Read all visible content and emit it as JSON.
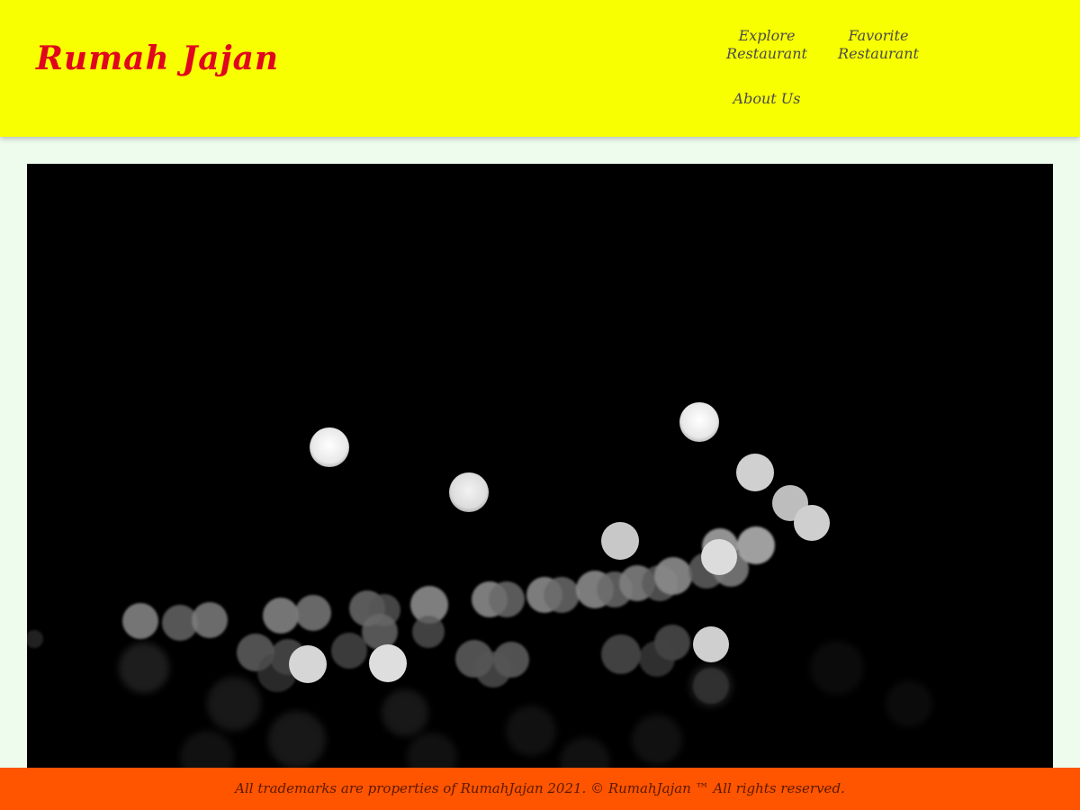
{
  "header": {
    "logo_text": "Rumah  Jajan",
    "nav": {
      "explore_label_line1": "Explore",
      "explore_label_line2": "Restaurant",
      "favorite_label_line1": "Favorite",
      "favorite_label_line2": "Restaurant",
      "about_label": "About Us"
    }
  },
  "hero": {
    "image_name": "hero-image"
  },
  "footer": {
    "text": "All trademarks are properties of RumahJajan 2021. © RumahJajan ™ All rights reserved."
  },
  "colors": {
    "header_bg": "#f7ff00",
    "logo": "#e0061e",
    "page_bg": "#eefcee",
    "footer_bg": "#ff5400"
  }
}
